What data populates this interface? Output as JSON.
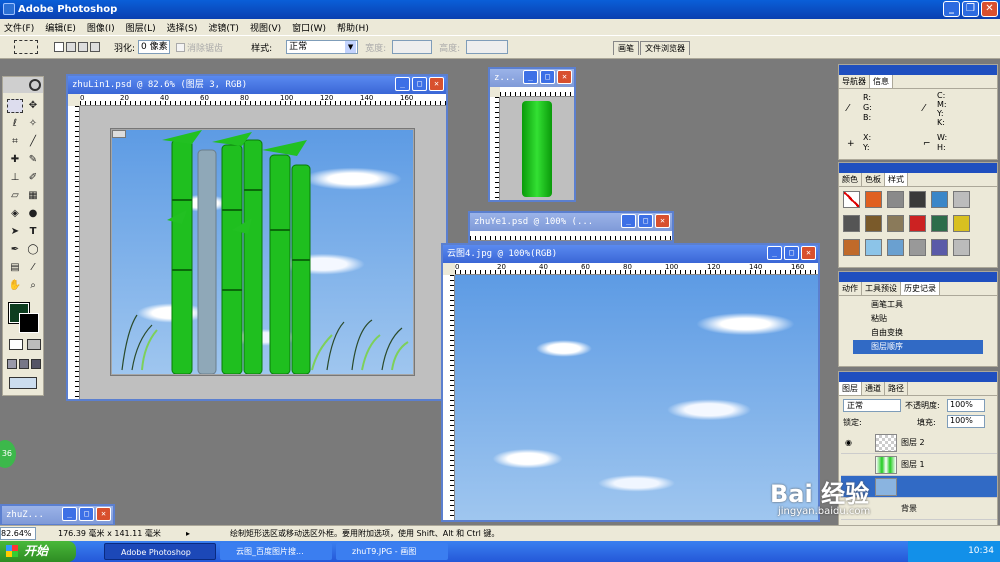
{
  "app": {
    "title": "Adobe Photoshop"
  },
  "menu": [
    "文件(F)",
    "编辑(E)",
    "图像(I)",
    "图层(L)",
    "选择(S)",
    "滤镜(T)",
    "视图(V)",
    "窗口(W)",
    "帮助(H)"
  ],
  "options": {
    "feather_label": "羽化:",
    "feather_value": "0 像素",
    "antialias_label": "消除锯齿",
    "style_label": "样式:",
    "style_value": "正常",
    "width_label": "宽度:",
    "height_label": "高度:"
  },
  "palette_well": {
    "tabs": [
      "画笔",
      "文件浏览器"
    ]
  },
  "documents": {
    "main": {
      "title": "zhuLin1.psd @ 82.6% (图层 3, RGB)",
      "ruler_marks": [
        "0",
        "20",
        "40",
        "60",
        "80",
        "100",
        "120",
        "140",
        "160"
      ]
    },
    "small_top": {
      "title": "z..."
    },
    "zhuye": {
      "title": "zhuYe1.psd @ 100% (..."
    },
    "cloud": {
      "title": "云图4.jpg @ 100%(RGB)",
      "ruler_marks": [
        "0",
        "20",
        "40",
        "60",
        "80",
        "100",
        "120",
        "140",
        "160"
      ]
    },
    "min_doc": {
      "title": "zhuZ..."
    }
  },
  "navigator": {
    "tabs": [
      "导航器",
      "信息"
    ],
    "r": "R:",
    "g": "G:",
    "b": "B:",
    "c": "C:",
    "m": "M:",
    "y": "Y:",
    "k": "K:",
    "x": "X:",
    "y2": "Y:",
    "w": "W:",
    "h": "H:"
  },
  "styles_panel": {
    "tabs": [
      "颜色",
      "色板",
      "样式"
    ]
  },
  "history": {
    "tabs": [
      "动作",
      "工具预设",
      "历史记录"
    ],
    "items": [
      "画笔工具",
      "粘贴",
      "自由变换",
      "图层顺序"
    ]
  },
  "layers": {
    "tabs": [
      "图层",
      "通道",
      "路径"
    ],
    "blend": "正常",
    "opacity_label": "不透明度:",
    "opacity": "100%",
    "lock_label": "锁定:",
    "fill_label": "填充:",
    "fill": "100%",
    "items": [
      "图层 2",
      "图层 1",
      "背景"
    ]
  },
  "status": {
    "zoom": "82.64%",
    "size": "176.39 毫米 x 141.11 毫米",
    "hint": "绘制矩形选区或移动选区外框。要用附加选项，使用 Shift、Alt 和 Ctrl 键。"
  },
  "taskbar": {
    "start": "开始",
    "tasks": [
      "Adobe Photoshop",
      "云图_百度图片搜...",
      "zhuT9.JPG - 画图"
    ],
    "clock": "10:34"
  },
  "watermark": {
    "text": "Bai 经验",
    "sub": "jingyan.baidu.com"
  },
  "badge": "36"
}
